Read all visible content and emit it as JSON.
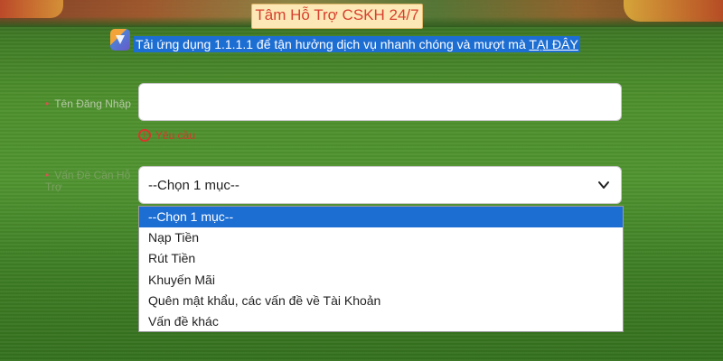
{
  "header": {
    "title": "Tâm Hỗ Trợ CSKH 24/7"
  },
  "notice": {
    "text": "Tải ứng dụng 1.1.1.1 để tận hưởng dịch vụ nhanh chóng và mượt mà ",
    "link_label": "TẠI ĐÂY",
    "icon": "app-icon"
  },
  "form": {
    "username": {
      "label": "Tên Đăng Nhập",
      "value": "",
      "error": "Yêu cầu"
    },
    "issue": {
      "label": "Vấn Đề Cần Hỗ Trợ",
      "selected": "--Chọn 1 mục--",
      "options": [
        "--Chọn 1 mục--",
        "Nạp Tiền",
        "Rút Tiền",
        "Khuyến Mãi",
        "Quên mật khẩu, các vấn đề về Tài Khoản",
        "Vấn đề khác"
      ]
    }
  },
  "colors": {
    "accent": "#1d6ed3",
    "error": "#d9362b",
    "banner_bg": "#fce8b6",
    "banner_text": "#d7402f"
  }
}
